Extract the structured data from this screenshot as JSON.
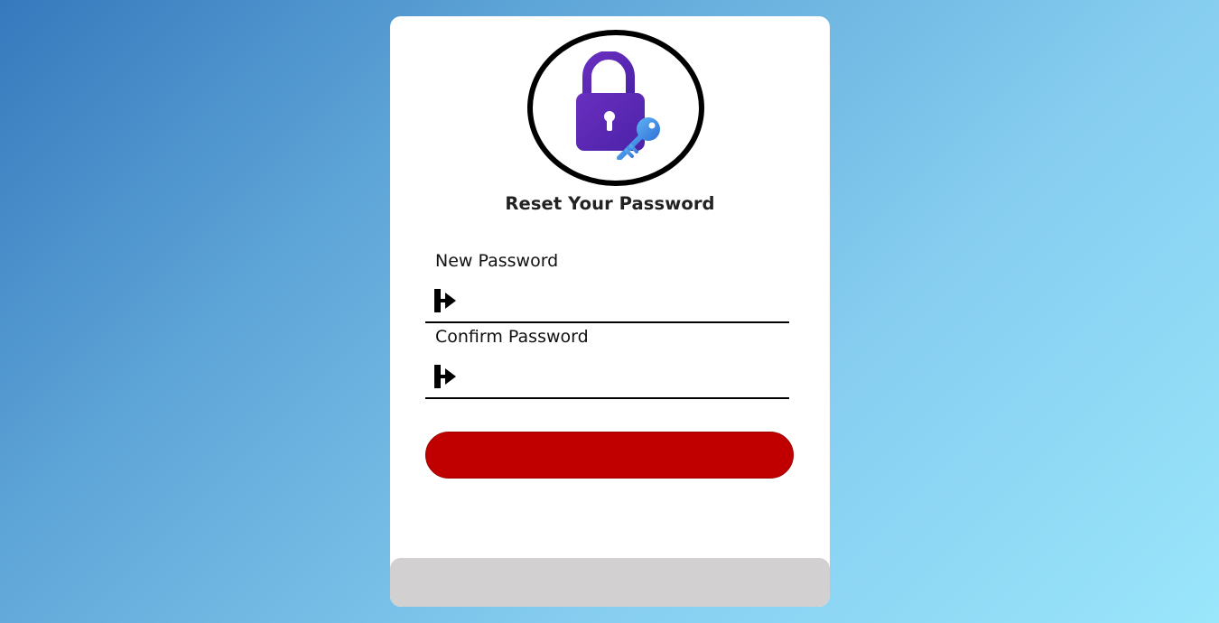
{
  "page": {
    "background_colors": [
      "#3679bd",
      "#9ae6fb"
    ]
  },
  "logo": {
    "icon": "padlock-key-icon",
    "lock_color": "#5b2bb5",
    "key_color": "#3f8ee8"
  },
  "form": {
    "title": "Reset Your Password",
    "fields": [
      {
        "label": "New Password",
        "icon": "login-arrow-icon",
        "value": "",
        "placeholder": ""
      },
      {
        "label": "Confirm Password",
        "icon": "login-arrow-icon",
        "value": "",
        "placeholder": ""
      }
    ],
    "submit": {
      "label": "",
      "color": "#c00000"
    }
  },
  "footer": {
    "color": "#d2d0d1"
  }
}
